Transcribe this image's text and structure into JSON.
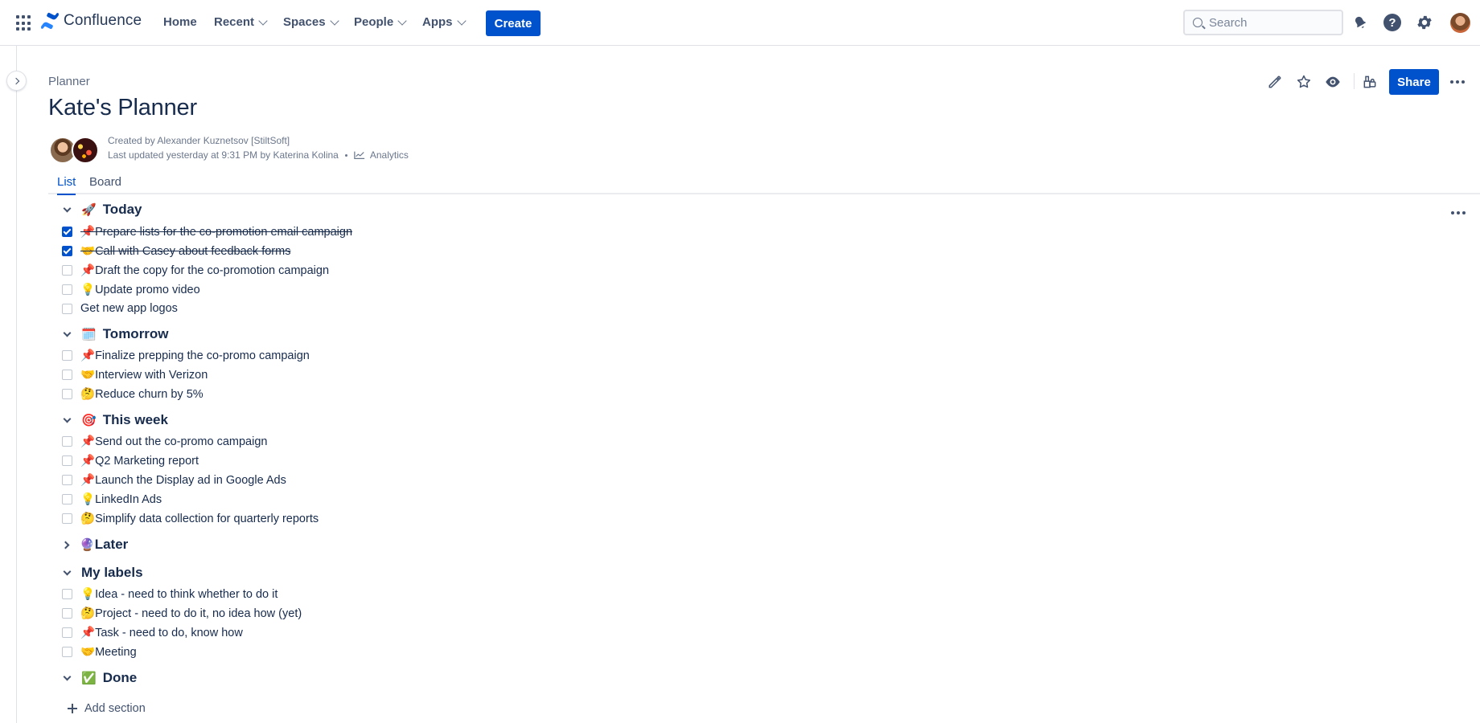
{
  "nav": {
    "logo_text": "Confluence",
    "items": [
      {
        "label": "Home",
        "dropdown": false
      },
      {
        "label": "Recent",
        "dropdown": true
      },
      {
        "label": "Spaces",
        "dropdown": true
      },
      {
        "label": "People",
        "dropdown": true
      },
      {
        "label": "Apps",
        "dropdown": true
      }
    ],
    "create_label": "Create",
    "search_placeholder": "Search",
    "icons": [
      "app-switcher-icon",
      "notifications-icon",
      "help-icon",
      "settings-icon",
      "profile-avatar"
    ]
  },
  "page": {
    "breadcrumb": "Planner",
    "title": "Kate's Planner",
    "created_by": "Created by Alexander Kuznetsov [StiltSoft]",
    "last_updated": "Last updated yesterday at 9:31 PM by Katerina Kolina",
    "analytics_label": "Analytics",
    "share_label": "Share",
    "action_icons": [
      "edit-icon",
      "star-icon",
      "watch-icon",
      "restrictions-icon",
      "more-icon"
    ]
  },
  "tabs": [
    {
      "label": "List",
      "active": true
    },
    {
      "label": "Board",
      "active": false
    }
  ],
  "sections": [
    {
      "emoji": "🚀",
      "title": "Today",
      "expanded": true,
      "tasks": [
        {
          "icon": "📌",
          "text": "Prepare lists for the co-promotion email campaign",
          "done": true
        },
        {
          "icon": "🤝",
          "text": "Call with Casey about feedback forms",
          "done": true
        },
        {
          "icon": "📌",
          "text": "Draft the copy for the co-promotion campaign",
          "done": false
        },
        {
          "icon": "💡",
          "text": "Update promo video",
          "done": false
        },
        {
          "icon": "",
          "text": "Get new app logos",
          "done": false
        }
      ]
    },
    {
      "emoji": "🗓️",
      "title": "Tomorrow",
      "expanded": true,
      "tasks": [
        {
          "icon": "📌",
          "text": "Finalize prepping the co-promo campaign",
          "done": false
        },
        {
          "icon": "🤝",
          "text": "Interview with Verizon",
          "done": false
        },
        {
          "icon": "🤔",
          "text": "Reduce churn by 5%",
          "done": false
        }
      ]
    },
    {
      "emoji": "🎯",
      "title": "This week",
      "expanded": true,
      "tasks": [
        {
          "icon": "📌",
          "text": "Send out the co-promo campaign",
          "done": false
        },
        {
          "icon": "📌",
          "text": "Q2 Marketing report",
          "done": false
        },
        {
          "icon": "📌",
          "text": "Launch the Display ad in Google Ads",
          "done": false
        },
        {
          "icon": "💡",
          "text": "LinkedIn Ads",
          "done": false
        },
        {
          "icon": "🤔",
          "text": "Simplify data collection for quarterly reports",
          "done": false
        }
      ]
    },
    {
      "emoji": "🔮",
      "title": "Later",
      "expanded": false,
      "tasks": []
    },
    {
      "emoji": "",
      "title": "My labels",
      "expanded": true,
      "tasks": [
        {
          "icon": "💡",
          "text": "Idea - need to think whether to do it",
          "done": false
        },
        {
          "icon": "🤔",
          "text": "Project - need to do it, no idea how (yet)",
          "done": false
        },
        {
          "icon": "📌",
          "text": "Task - need to do, know how",
          "done": false
        },
        {
          "icon": "🤝",
          "text": "Meeting",
          "done": false
        }
      ]
    },
    {
      "emoji": "✅",
      "title": "Done",
      "expanded": true,
      "tasks": []
    }
  ],
  "add_section_label": "Add section",
  "colors": {
    "primary": "#0052cc",
    "text": "#172b4d",
    "subtle": "#6b778c",
    "border": "#dfe1e6"
  }
}
